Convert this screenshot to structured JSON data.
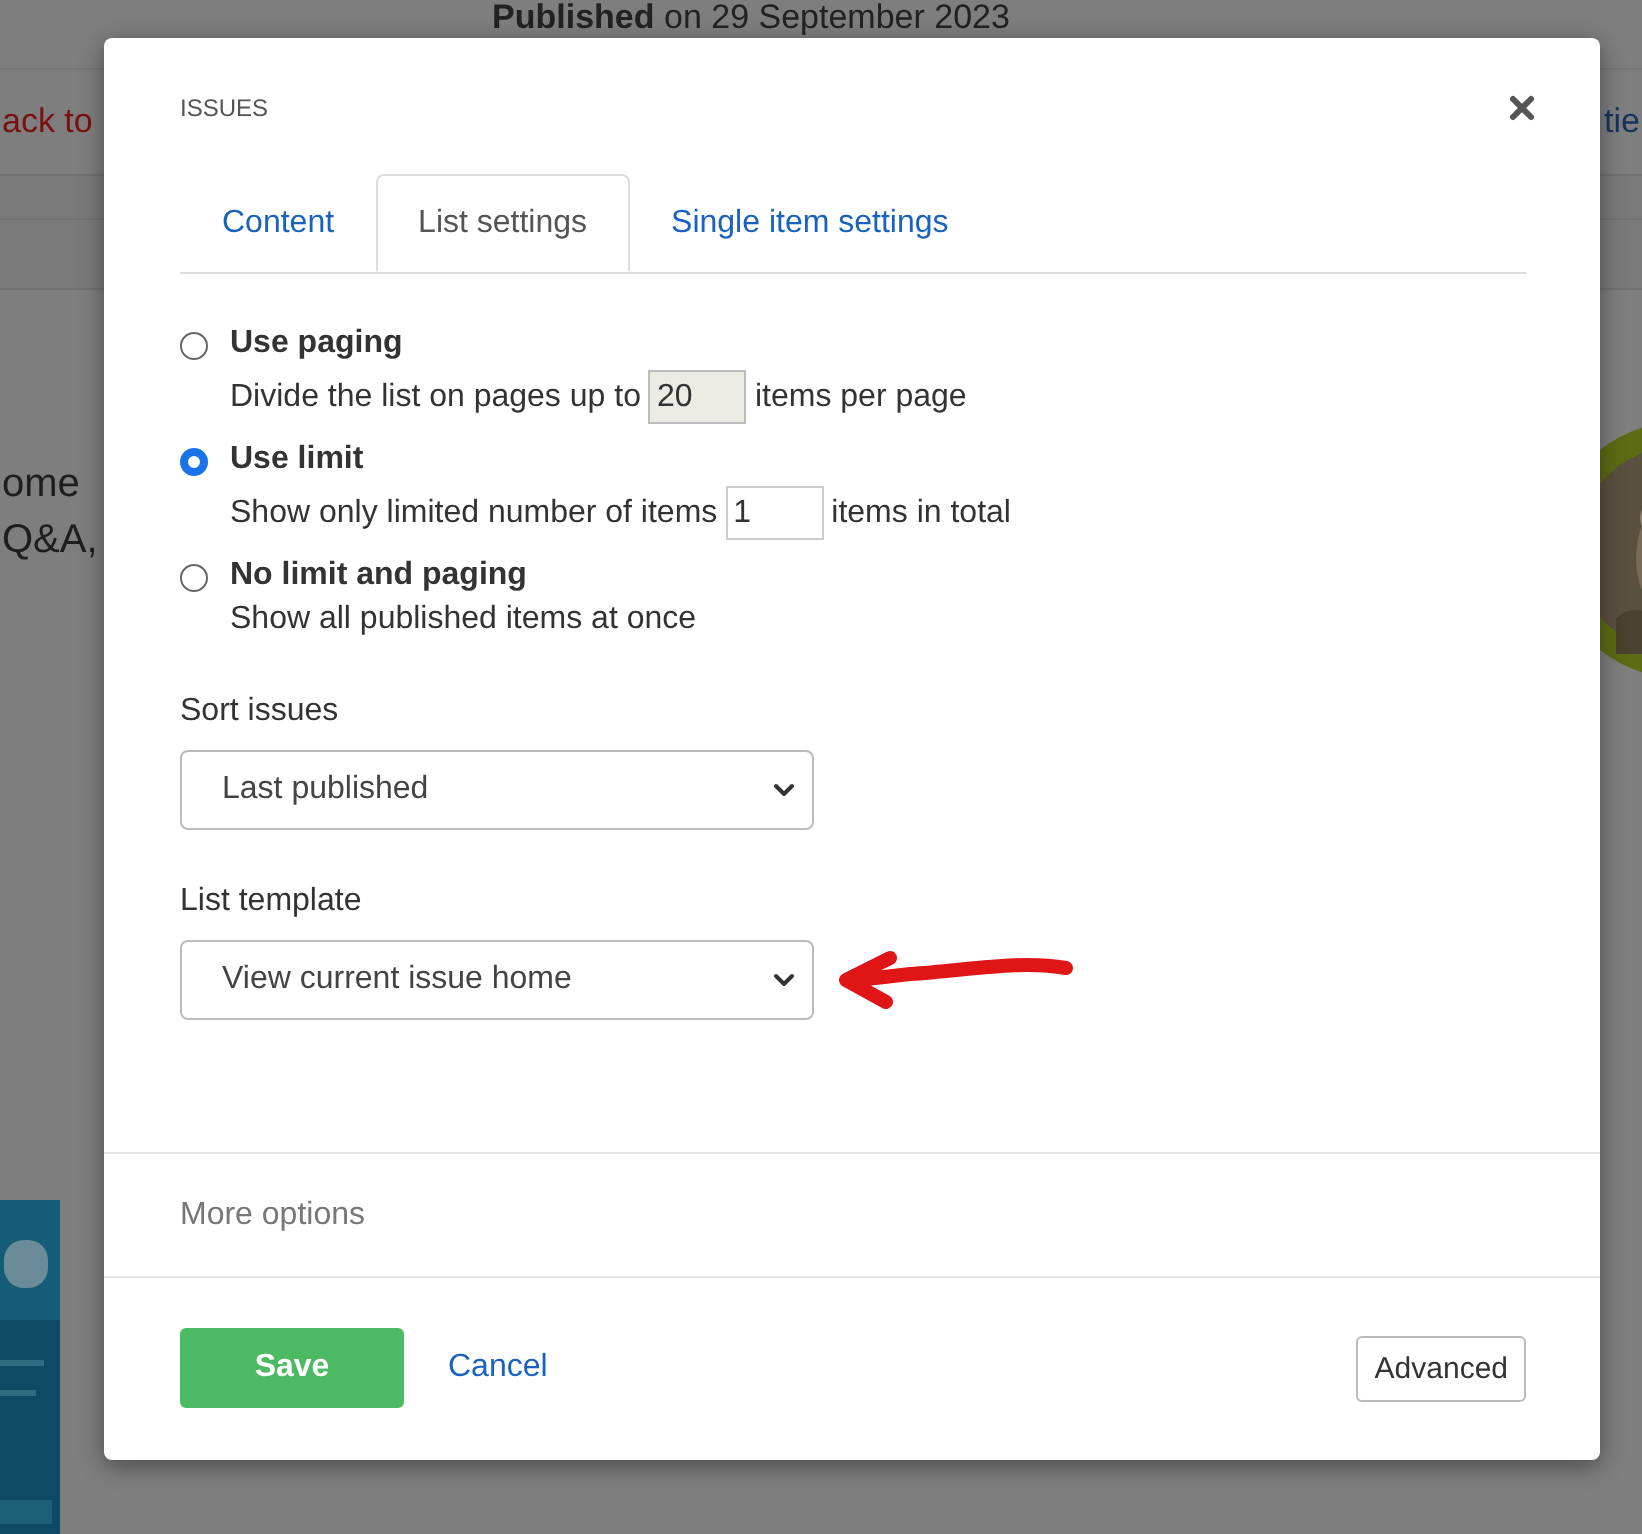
{
  "background": {
    "published": "**Published** on 29 September 2023",
    "back_link": "ack to",
    "right_link": "tie",
    "teaser_lines": [
      "ome",
      "Q&A,"
    ]
  },
  "dialog": {
    "title": "ISSUES",
    "tabs": [
      {
        "label": "Content",
        "selected": false
      },
      {
        "label": "List settings",
        "selected": true
      },
      {
        "label": "Single item settings",
        "selected": false
      }
    ],
    "options": [
      {
        "label": "Use paging",
        "selected": false,
        "before": "Divide the list on pages up to",
        "input": {
          "value": "20",
          "disabled": true
        },
        "after": "items per page"
      },
      {
        "label": "Use limit",
        "selected": true,
        "before": "Show only limited number of items",
        "input": {
          "value": "1",
          "disabled": false
        },
        "after": "items in total"
      },
      {
        "label": "No limit and paging",
        "selected": false,
        "before": "Show all published items at once"
      }
    ],
    "selects": [
      {
        "label": "Sort issues",
        "value": "Last published"
      },
      {
        "label": "List template",
        "value": "View current issue home",
        "annotation": {
          "kind": "arrow"
        }
      }
    ],
    "more_options": "More options",
    "buttons": {
      "save": "Save",
      "cancel": "Cancel",
      "advanced": "Advanced"
    }
  }
}
